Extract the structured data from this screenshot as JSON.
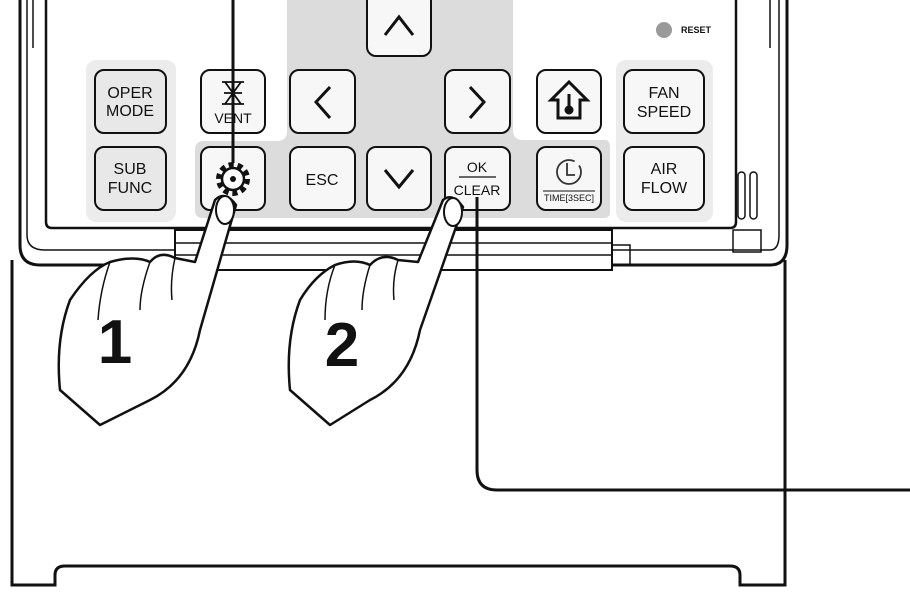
{
  "buttons": {
    "oper_mode": [
      "OPER",
      "MODE"
    ],
    "vent": "VENT",
    "fan_speed": [
      "FAN",
      "SPEED"
    ],
    "sub_func": [
      "SUB",
      "FUNC"
    ],
    "esc": "ESC",
    "ok_clear": [
      "OK",
      "CLEAR"
    ],
    "time": "TIME[3SEC]",
    "air_flow": [
      "AIR",
      "FLOW"
    ],
    "reset": "RESET"
  },
  "steps": [
    "1",
    "2"
  ],
  "icons": [
    "up-arrow",
    "left-arrow",
    "right-arrow",
    "down-arrow",
    "vent-fan",
    "settings-gear",
    "home-thermometer",
    "clock"
  ],
  "colors": {
    "panel_grey": "#dcdcdc",
    "reset_dot": "#9a9a9a",
    "outline": "#111111"
  }
}
